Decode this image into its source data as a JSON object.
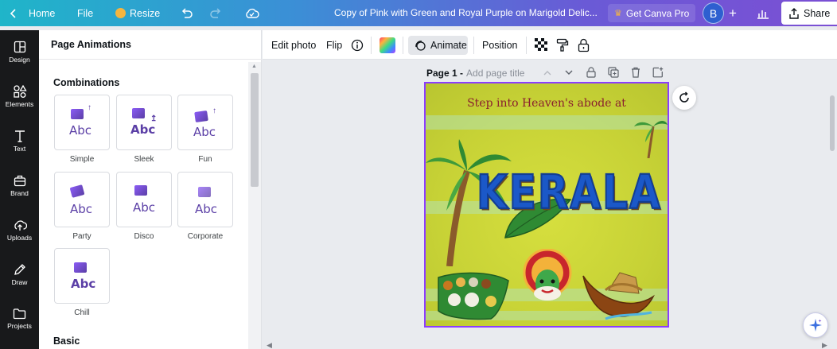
{
  "topbar": {
    "home_label": "Home",
    "file_label": "File",
    "resize_label": "Resize",
    "doc_title": "Copy of Pink with Green and Royal Purple on Marigold Delic...",
    "get_pro_label": "Get Canva Pro",
    "avatar_initial": "B",
    "share_label": "Share"
  },
  "rail": {
    "items": [
      {
        "label": "Design",
        "icon": "layout-icon"
      },
      {
        "label": "Elements",
        "icon": "shapes-icon"
      },
      {
        "label": "Text",
        "icon": "text-icon"
      },
      {
        "label": "Brand",
        "icon": "briefcase-icon"
      },
      {
        "label": "Uploads",
        "icon": "upload-cloud-icon"
      },
      {
        "label": "Draw",
        "icon": "pen-icon"
      },
      {
        "label": "Projects",
        "icon": "folder-icon"
      }
    ]
  },
  "panel": {
    "title": "Page Animations",
    "combinations_title": "Combinations",
    "basic_title": "Basic",
    "thumb_text": "Abc",
    "animations": [
      {
        "label": "Simple"
      },
      {
        "label": "Sleek"
      },
      {
        "label": "Fun"
      },
      {
        "label": "Party"
      },
      {
        "label": "Disco"
      },
      {
        "label": "Corporate"
      },
      {
        "label": "Chill"
      }
    ]
  },
  "toolbar": {
    "edit_photo_label": "Edit photo",
    "flip_label": "Flip",
    "animate_label": "Animate",
    "position_label": "Position"
  },
  "page": {
    "name": "Page 1 -",
    "title_placeholder": "Add page title"
  },
  "canvas": {
    "headline": "Step into Heaven's abode at",
    "hero_word": "KERALA"
  },
  "colors": {
    "accent": "#8b3dff",
    "canvas_bg": "#c7d236",
    "headline": "#8a1f2e",
    "hero": "#1b58c8"
  }
}
